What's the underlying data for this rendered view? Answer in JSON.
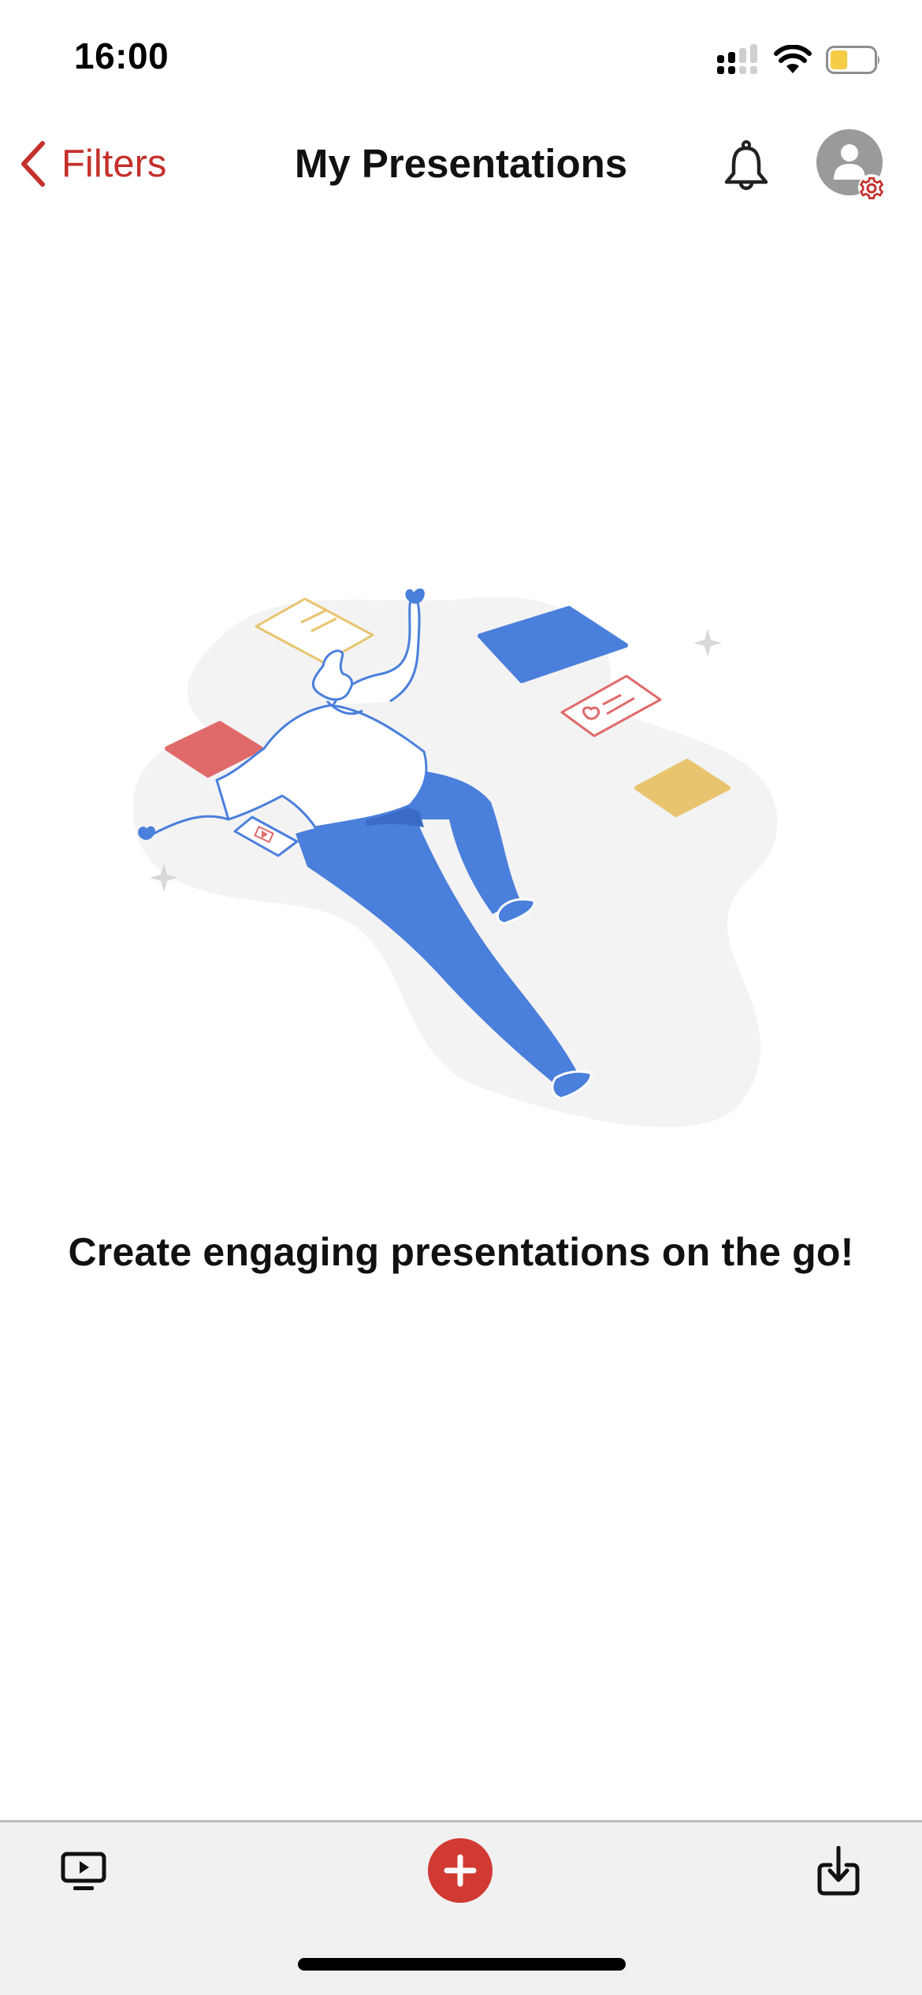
{
  "status_bar": {
    "time": "16:00",
    "signal_icon": "dual-sim-signal-icon",
    "signal_bars_sim1": 2,
    "signal_bars_sim2": 2,
    "signal_bars_max": 4,
    "wifi_icon": "wifi-icon",
    "battery_icon": "battery-icon",
    "battery_level": 0.4,
    "battery_low_power_mode": true
  },
  "nav": {
    "back_label": "Filters",
    "back_icon": "chevron-left-icon",
    "title": "My Presentations",
    "notifications_icon": "bell-icon",
    "account_icon": "account-settings-icon"
  },
  "empty_state": {
    "illustration": "person-floating-among-slides-illustration",
    "message": "Create engaging presentations on the go!"
  },
  "toolbar": {
    "present_icon": "present-monitor-icon",
    "add_icon": "plus-circle-icon",
    "import_icon": "import-download-icon"
  },
  "colors": {
    "accent": "#c4302b",
    "add_button": "#d03a33",
    "illustration_blue": "#4a7fdc",
    "illustration_red": "#e06a6a",
    "illustration_yellow": "#e8c46e",
    "battery_fill": "#f5cc45",
    "toolbar_bg": "#f1f1f1"
  }
}
